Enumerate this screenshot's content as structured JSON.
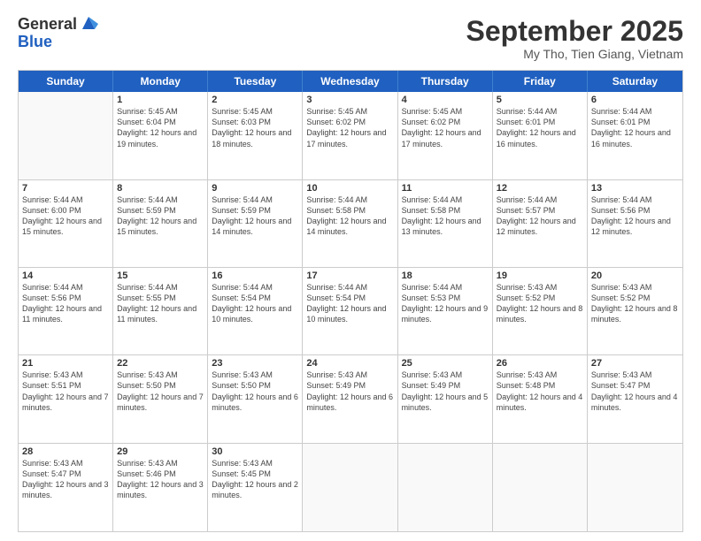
{
  "header": {
    "logo_general": "General",
    "logo_blue": "Blue",
    "month_title": "September 2025",
    "subtitle": "My Tho, Tien Giang, Vietnam"
  },
  "days_of_week": [
    "Sunday",
    "Monday",
    "Tuesday",
    "Wednesday",
    "Thursday",
    "Friday",
    "Saturday"
  ],
  "weeks": [
    [
      {
        "day": "",
        "empty": true
      },
      {
        "day": "1",
        "sunrise": "Sunrise: 5:45 AM",
        "sunset": "Sunset: 6:04 PM",
        "daylight": "Daylight: 12 hours and 19 minutes."
      },
      {
        "day": "2",
        "sunrise": "Sunrise: 5:45 AM",
        "sunset": "Sunset: 6:03 PM",
        "daylight": "Daylight: 12 hours and 18 minutes."
      },
      {
        "day": "3",
        "sunrise": "Sunrise: 5:45 AM",
        "sunset": "Sunset: 6:02 PM",
        "daylight": "Daylight: 12 hours and 17 minutes."
      },
      {
        "day": "4",
        "sunrise": "Sunrise: 5:45 AM",
        "sunset": "Sunset: 6:02 PM",
        "daylight": "Daylight: 12 hours and 17 minutes."
      },
      {
        "day": "5",
        "sunrise": "Sunrise: 5:44 AM",
        "sunset": "Sunset: 6:01 PM",
        "daylight": "Daylight: 12 hours and 16 minutes."
      },
      {
        "day": "6",
        "sunrise": "Sunrise: 5:44 AM",
        "sunset": "Sunset: 6:01 PM",
        "daylight": "Daylight: 12 hours and 16 minutes."
      }
    ],
    [
      {
        "day": "7",
        "sunrise": "Sunrise: 5:44 AM",
        "sunset": "Sunset: 6:00 PM",
        "daylight": "Daylight: 12 hours and 15 minutes."
      },
      {
        "day": "8",
        "sunrise": "Sunrise: 5:44 AM",
        "sunset": "Sunset: 5:59 PM",
        "daylight": "Daylight: 12 hours and 15 minutes."
      },
      {
        "day": "9",
        "sunrise": "Sunrise: 5:44 AM",
        "sunset": "Sunset: 5:59 PM",
        "daylight": "Daylight: 12 hours and 14 minutes."
      },
      {
        "day": "10",
        "sunrise": "Sunrise: 5:44 AM",
        "sunset": "Sunset: 5:58 PM",
        "daylight": "Daylight: 12 hours and 14 minutes."
      },
      {
        "day": "11",
        "sunrise": "Sunrise: 5:44 AM",
        "sunset": "Sunset: 5:58 PM",
        "daylight": "Daylight: 12 hours and 13 minutes."
      },
      {
        "day": "12",
        "sunrise": "Sunrise: 5:44 AM",
        "sunset": "Sunset: 5:57 PM",
        "daylight": "Daylight: 12 hours and 12 minutes."
      },
      {
        "day": "13",
        "sunrise": "Sunrise: 5:44 AM",
        "sunset": "Sunset: 5:56 PM",
        "daylight": "Daylight: 12 hours and 12 minutes."
      }
    ],
    [
      {
        "day": "14",
        "sunrise": "Sunrise: 5:44 AM",
        "sunset": "Sunset: 5:56 PM",
        "daylight": "Daylight: 12 hours and 11 minutes."
      },
      {
        "day": "15",
        "sunrise": "Sunrise: 5:44 AM",
        "sunset": "Sunset: 5:55 PM",
        "daylight": "Daylight: 12 hours and 11 minutes."
      },
      {
        "day": "16",
        "sunrise": "Sunrise: 5:44 AM",
        "sunset": "Sunset: 5:54 PM",
        "daylight": "Daylight: 12 hours and 10 minutes."
      },
      {
        "day": "17",
        "sunrise": "Sunrise: 5:44 AM",
        "sunset": "Sunset: 5:54 PM",
        "daylight": "Daylight: 12 hours and 10 minutes."
      },
      {
        "day": "18",
        "sunrise": "Sunrise: 5:44 AM",
        "sunset": "Sunset: 5:53 PM",
        "daylight": "Daylight: 12 hours and 9 minutes."
      },
      {
        "day": "19",
        "sunrise": "Sunrise: 5:43 AM",
        "sunset": "Sunset: 5:52 PM",
        "daylight": "Daylight: 12 hours and 8 minutes."
      },
      {
        "day": "20",
        "sunrise": "Sunrise: 5:43 AM",
        "sunset": "Sunset: 5:52 PM",
        "daylight": "Daylight: 12 hours and 8 minutes."
      }
    ],
    [
      {
        "day": "21",
        "sunrise": "Sunrise: 5:43 AM",
        "sunset": "Sunset: 5:51 PM",
        "daylight": "Daylight: 12 hours and 7 minutes."
      },
      {
        "day": "22",
        "sunrise": "Sunrise: 5:43 AM",
        "sunset": "Sunset: 5:50 PM",
        "daylight": "Daylight: 12 hours and 7 minutes."
      },
      {
        "day": "23",
        "sunrise": "Sunrise: 5:43 AM",
        "sunset": "Sunset: 5:50 PM",
        "daylight": "Daylight: 12 hours and 6 minutes."
      },
      {
        "day": "24",
        "sunrise": "Sunrise: 5:43 AM",
        "sunset": "Sunset: 5:49 PM",
        "daylight": "Daylight: 12 hours and 6 minutes."
      },
      {
        "day": "25",
        "sunrise": "Sunrise: 5:43 AM",
        "sunset": "Sunset: 5:49 PM",
        "daylight": "Daylight: 12 hours and 5 minutes."
      },
      {
        "day": "26",
        "sunrise": "Sunrise: 5:43 AM",
        "sunset": "Sunset: 5:48 PM",
        "daylight": "Daylight: 12 hours and 4 minutes."
      },
      {
        "day": "27",
        "sunrise": "Sunrise: 5:43 AM",
        "sunset": "Sunset: 5:47 PM",
        "daylight": "Daylight: 12 hours and 4 minutes."
      }
    ],
    [
      {
        "day": "28",
        "sunrise": "Sunrise: 5:43 AM",
        "sunset": "Sunset: 5:47 PM",
        "daylight": "Daylight: 12 hours and 3 minutes."
      },
      {
        "day": "29",
        "sunrise": "Sunrise: 5:43 AM",
        "sunset": "Sunset: 5:46 PM",
        "daylight": "Daylight: 12 hours and 3 minutes."
      },
      {
        "day": "30",
        "sunrise": "Sunrise: 5:43 AM",
        "sunset": "Sunset: 5:45 PM",
        "daylight": "Daylight: 12 hours and 2 minutes."
      },
      {
        "day": "",
        "empty": true
      },
      {
        "day": "",
        "empty": true
      },
      {
        "day": "",
        "empty": true
      },
      {
        "day": "",
        "empty": true
      }
    ]
  ]
}
